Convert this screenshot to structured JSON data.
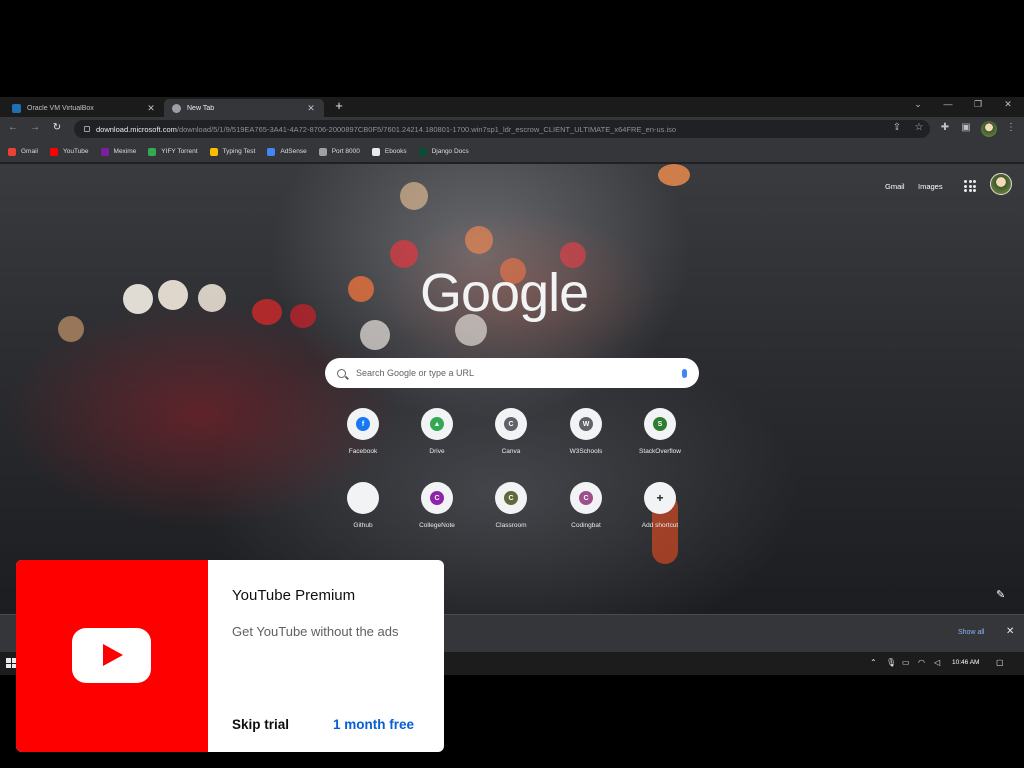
{
  "tabs": [
    {
      "title": "Oracle VM VirtualBox",
      "icon": "virtualbox-icon",
      "color": "#1f6fb2"
    },
    {
      "title": "New Tab",
      "icon": "chrome-icon",
      "color": "#9aa0a6"
    }
  ],
  "toolbar": {
    "url_host": "download.microsoft.com",
    "url_path": "/download/5/1/9/519EA765-3A41-4A72-8706-2000897CB0F5/7601.24214.180801-1700.win7sp1_ldr_escrow_CLIENT_ULTIMATE_x64FRE_en-us.iso"
  },
  "bookmarks": [
    {
      "label": "Gmail",
      "color": "#ea4335"
    },
    {
      "label": "YouTube",
      "color": "#ff0000"
    },
    {
      "label": "Mexime",
      "color": "#7b1fa2"
    },
    {
      "label": "YIFY Torrent",
      "color": "#34a853"
    },
    {
      "label": "Typing Test",
      "color": "#fbbc04"
    },
    {
      "label": "AdSense",
      "color": "#4285f4"
    },
    {
      "label": "Port 8000",
      "color": "#9aa0a6"
    },
    {
      "label": "Ebooks",
      "color": "#e8eaed"
    },
    {
      "label": "Django Docs",
      "color": "#0c4b33"
    }
  ],
  "google_top": {
    "gmail": "Gmail",
    "images": "Images"
  },
  "logo_text": "Google",
  "search": {
    "placeholder": "Search Google or type a URL"
  },
  "shortcuts_row1": [
    {
      "label": "Facebook",
      "initial": "f",
      "color": "#1877f2"
    },
    {
      "label": "Drive",
      "initial": "▲",
      "color": "#34a853"
    },
    {
      "label": "Canva",
      "initial": "C",
      "color": "#5f6368"
    },
    {
      "label": "W3Schools",
      "initial": "W",
      "color": "#5f6368"
    },
    {
      "label": "StackOverflow",
      "initial": "S",
      "color": "#2e7d32"
    }
  ],
  "shortcuts_row2": [
    {
      "label": "Github",
      "initial": "",
      "color": "#f1f3f4"
    },
    {
      "label": "CollegeNote",
      "initial": "C",
      "color": "#8e24aa"
    },
    {
      "label": "Classroom",
      "initial": "C",
      "color": "#5d6b3a"
    },
    {
      "label": "Codingbat",
      "initial": "C",
      "color": "#9c4f8b"
    },
    {
      "label": "Add shortcut",
      "initial": "+",
      "color": "#f1f3f4"
    }
  ],
  "downloads": {
    "show_all": "Show all"
  },
  "taskbar": {
    "time": "10:46 AM"
  },
  "yt_card": {
    "title": "YouTube Premium",
    "subtitle": "Get YouTube without the ads",
    "skip": "Skip trial",
    "offer": "1 month free",
    "brand_color": "#ff0000"
  }
}
